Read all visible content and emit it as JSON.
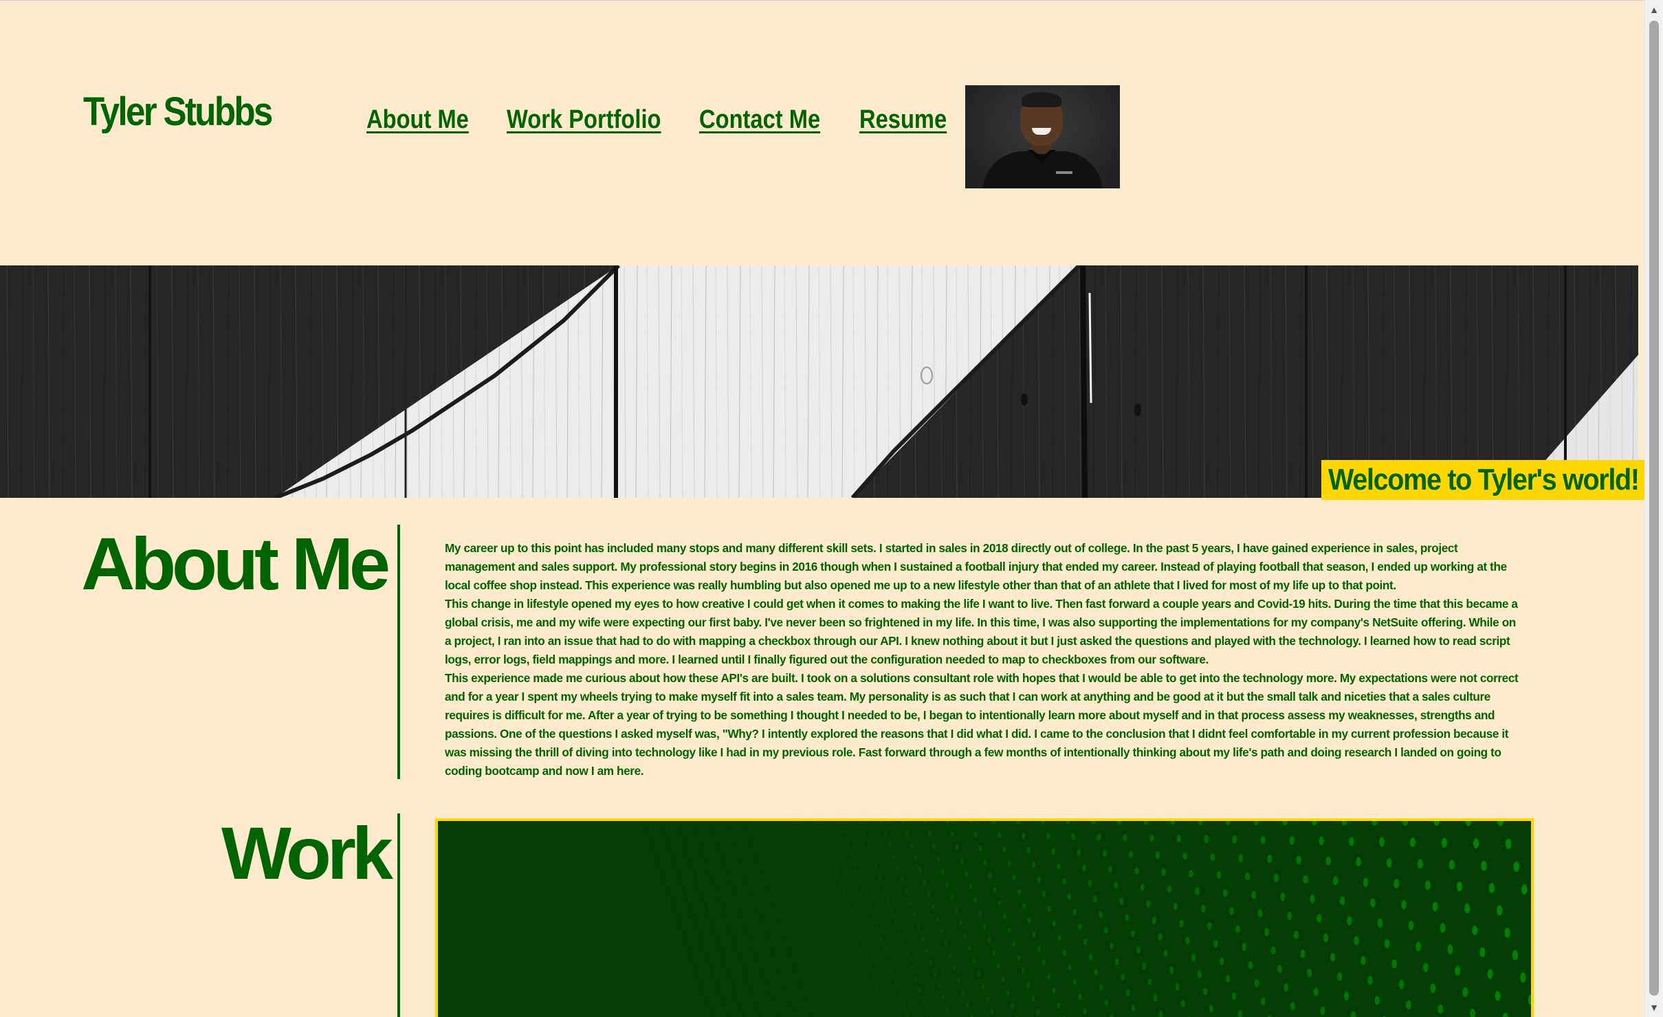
{
  "header": {
    "site_title": "Tyler Stubbs",
    "nav": [
      {
        "label": "About Me"
      },
      {
        "label": "Work Portfolio"
      },
      {
        "label": "Contact Me"
      },
      {
        "label": "Resume"
      }
    ]
  },
  "banner": {
    "welcome_text": "Welcome to Tyler's world!"
  },
  "about": {
    "heading": "About Me",
    "paragraphs": [
      "My career up to this point has included many stops and many different skill sets. I started in sales in 2018 directly out of college. In the past 5 years, I have gained experience in sales, project management and sales support. My professional story begins in 2016 though when I sustained a football injury that ended my career. Instead of playing football that season, I ended up working at the local coffee shop instead. This experience was really humbling but also opened me up to a new lifestyle other than that of an athlete that I lived for most of my life up to that point.",
      "This change in lifestyle opened my eyes to how creative I could get when it comes to making the life I want to live. Then fast forward a couple years and Covid-19 hits. During the time that this became a global crisis, me and my wife were expecting our first baby. I've never been so frightened in my life. In this time, I was also supporting the implementations for my company's NetSuite offering. While on a project, I ran into an issue that had to do with mapping a checkbox through our API. I knew nothing about it but I just asked the questions and played with the technology. I learned how to read script logs, error logs, field mappings and more. I learned until I finally figured out the configuration needed to map to checkboxes from our software.",
      "This experience made me curious about how these API's are built. I took on a solutions consultant role with hopes that I would be able to get into the technology more. My expectations were not correct and for a year I spent my wheels trying to make myself fit into a sales team. My personality is as such that I can work at anything and be good at it but the small talk and niceties that a sales culture requires is difficult for me. After a year of trying to be something I thought I needed to be, I began to intentionally learn more about myself and in that process assess my weaknesses, strengths and passions. One of the questions I asked myself was, \"Why? I intently explored the reasons that I did what I did. I came to the conclusion that I didnt feel comfortable in my current profession because it was missing the thrill of diving into technology like I had in my previous role. Fast forward through a few months of intentionally thinking about my life's path and doing research I landed on going to coding bootcamp and now I am here."
    ]
  },
  "work": {
    "heading": "Work"
  },
  "colors": {
    "background": "#feebcd",
    "primary_green": "#006400",
    "accent_yellow": "#ffd700"
  },
  "icons": {
    "scroll_up": "scroll-up-arrow-icon",
    "scroll_down": "scroll-down-arrow-icon"
  }
}
